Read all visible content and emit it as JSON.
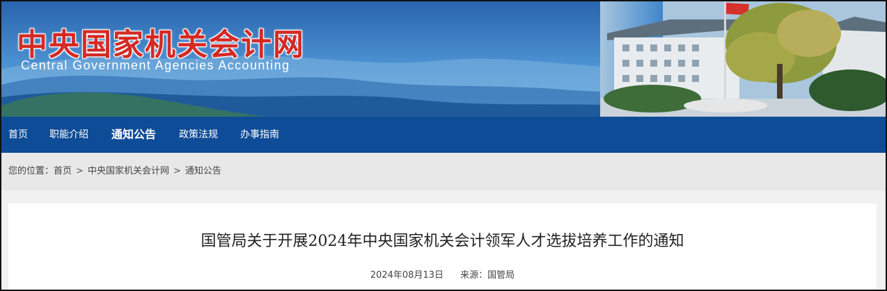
{
  "header": {
    "site_title": "中央国家机关会计网",
    "site_subtitle": "Central Government Agencies Accounting"
  },
  "nav": {
    "items": [
      {
        "label": "首页"
      },
      {
        "label": "职能介绍"
      },
      {
        "label": "通知公告",
        "active": true
      },
      {
        "label": "政策法规"
      },
      {
        "label": "办事指南"
      }
    ]
  },
  "breadcrumb": {
    "prefix": "您的位置：",
    "items": [
      "首页",
      "中央国家机关会计网",
      "通知公告"
    ],
    "separator": ">"
  },
  "article": {
    "title": "国管局关于开展2024年中央国家机关会计领军人才选拔培养工作的通知",
    "date": "2024年08月13日",
    "source": "来源：国管局"
  },
  "colors": {
    "nav_bg": "#0f4c97",
    "title_red": "#d42a25",
    "breadcrumb_bg": "#e8e8e8"
  }
}
